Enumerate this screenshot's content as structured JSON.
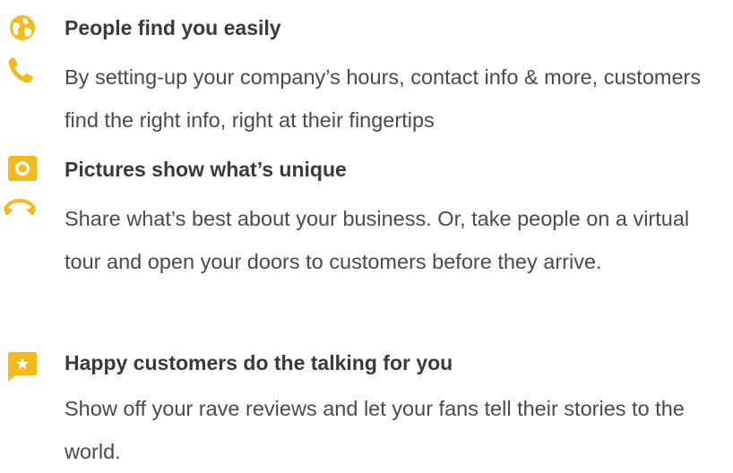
{
  "colors": {
    "accent": "#f5b91a",
    "title_text": "#3a3a3a",
    "body_text": "#4a4a4a"
  },
  "features": [
    {
      "title": "People find you easily",
      "icons": [
        "globe-icon",
        "phone-icon"
      ],
      "body": "By setting-up your company’s hours, contact info & more, customers find the right info, right at their fingertips"
    },
    {
      "title": "Pictures show what’s unique",
      "icons": [
        "camera-icon",
        "360-tour-icon"
      ],
      "body": "Share what’s best about your business. Or, take people on a virtual tour and open your doors to customers before they arrive."
    },
    {
      "title": "Happy customers do the talking for you",
      "icons": [
        "review-star-icon"
      ],
      "body": "Show off your rave reviews and let your fans tell their stories to the world."
    }
  ]
}
